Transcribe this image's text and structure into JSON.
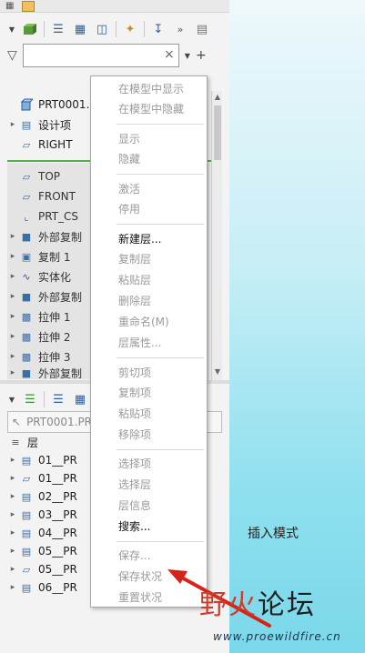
{
  "tabs": [
    {
      "name": "model-tree-tab",
      "icon": "hierarchy-icon"
    },
    {
      "name": "folder-tab",
      "icon": "folder-icon"
    }
  ],
  "search": {
    "value": "",
    "placeholder": ""
  },
  "tree_top": [
    {
      "label": "PRT0001.PR",
      "icon": "part-icon",
      "expand": ""
    },
    {
      "label": "设计项",
      "icon": "list-icon",
      "expand": "▸"
    },
    {
      "label": "RIGHT",
      "icon": "datum-plane-icon",
      "expand": ""
    },
    {
      "label": "TOP",
      "icon": "datum-plane-icon",
      "expand": ""
    },
    {
      "label": "FRONT",
      "icon": "datum-plane-icon",
      "expand": ""
    },
    {
      "label": "PRT_CS",
      "icon": "coordinate-system-icon",
      "expand": ""
    },
    {
      "label": "外部复制",
      "icon": "external-copy-icon",
      "expand": "▸"
    },
    {
      "label": "复制 1",
      "icon": "copy-geom-icon",
      "expand": "▸"
    },
    {
      "label": "实体化",
      "icon": "solidify-icon",
      "expand": "▸"
    },
    {
      "label": "外部复制",
      "icon": "external-copy-icon",
      "expand": "▸"
    },
    {
      "label": "拉伸 1",
      "icon": "extrude-icon",
      "expand": "▸"
    },
    {
      "label": "拉伸 2",
      "icon": "extrude-icon",
      "expand": "▸"
    },
    {
      "label": "拉伸 3",
      "icon": "extrude-icon",
      "expand": "▸"
    },
    {
      "label": "外部复制",
      "icon": "external-copy-icon",
      "expand": "▸"
    }
  ],
  "model_select": {
    "value": "PRT0001.PR"
  },
  "layers": {
    "header": "层",
    "items": [
      {
        "label": "01__PR",
        "icon": "layer-list-icon"
      },
      {
        "label": "01__PR",
        "icon": "layer-plane-icon"
      },
      {
        "label": "02__PR",
        "icon": "layer-list-icon"
      },
      {
        "label": "03__PR",
        "icon": "layer-list-icon"
      },
      {
        "label": "04__PR",
        "icon": "layer-list-icon"
      },
      {
        "label": "05__PR",
        "icon": "layer-list-icon"
      },
      {
        "label": "05__PR",
        "icon": "layer-plane-icon"
      },
      {
        "label": "06__PR",
        "icon": "layer-list-icon"
      }
    ]
  },
  "context_menu": {
    "items": [
      {
        "label": "在模型中显示",
        "enabled": false
      },
      {
        "label": "在模型中隐藏",
        "enabled": false
      },
      {
        "label": "显示",
        "enabled": false
      },
      {
        "label": "隐藏",
        "enabled": false
      },
      {
        "label": "激活",
        "enabled": false
      },
      {
        "label": "停用",
        "enabled": false
      },
      {
        "label": "新建层...",
        "enabled": true
      },
      {
        "label": "复制层",
        "enabled": false
      },
      {
        "label": "粘贴层",
        "enabled": false
      },
      {
        "label": "删除层",
        "enabled": false
      },
      {
        "label": "重命名(M)",
        "enabled": false
      },
      {
        "label": "层属性...",
        "enabled": false
      },
      {
        "label": "剪切项",
        "enabled": false
      },
      {
        "label": "复制项",
        "enabled": false
      },
      {
        "label": "粘贴项",
        "enabled": false
      },
      {
        "label": "移除项",
        "enabled": false
      },
      {
        "label": "选择项",
        "enabled": false
      },
      {
        "label": "选择层",
        "enabled": false
      },
      {
        "label": "层信息",
        "enabled": false
      },
      {
        "label": "搜索...",
        "enabled": true
      },
      {
        "label": "保存...",
        "enabled": false
      },
      {
        "label": "保存状况",
        "enabled": false
      },
      {
        "label": "重置状况",
        "enabled": false
      }
    ]
  },
  "status": {
    "mode": "插入模式"
  },
  "watermark": {
    "red": "野火",
    "black": "论坛",
    "url": "www.proewildfire.cn"
  },
  "colors": {
    "accent": "#2f5f9a",
    "green_insert_line": "#55b04a",
    "arrow": "#d8231a"
  }
}
